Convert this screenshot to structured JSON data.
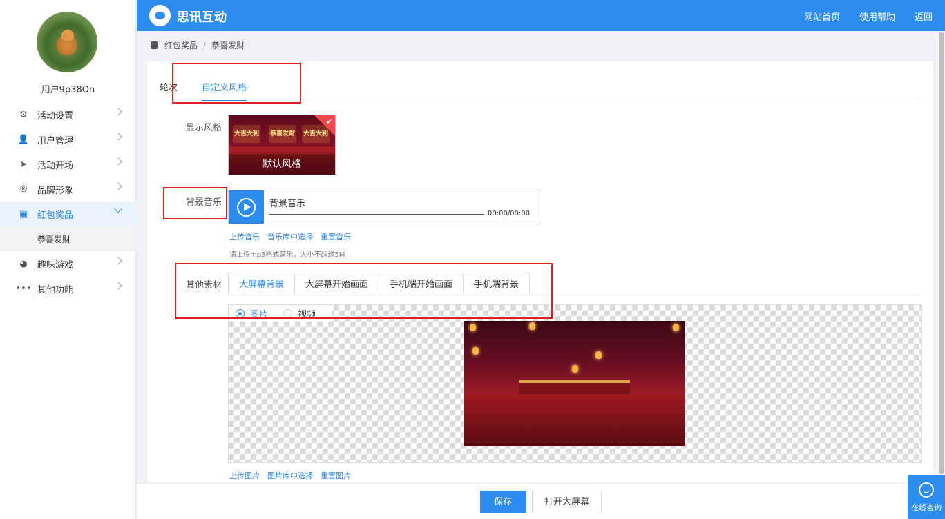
{
  "app": {
    "title": "思讯互动"
  },
  "nav": {
    "home": "网站首页",
    "help": "使用帮助",
    "back": "返回"
  },
  "user": {
    "name": "用户9p38On"
  },
  "sidebar": {
    "items": [
      {
        "label": "活动设置",
        "icon": "gear-icon"
      },
      {
        "label": "用户管理",
        "icon": "user-icon"
      },
      {
        "label": "活动开场",
        "icon": "paper-plane-icon"
      },
      {
        "label": "品牌形象",
        "icon": "registered-icon"
      },
      {
        "label": "红包奖品",
        "icon": "gift-icon"
      },
      {
        "label": "趣味游戏",
        "icon": "game-icon"
      },
      {
        "label": "其他功能",
        "icon": "more-icon"
      }
    ],
    "submenu": {
      "label": "恭喜发财"
    }
  },
  "breadcrumb": {
    "parent": "红包奖品",
    "current": "恭喜发财"
  },
  "tabs": [
    {
      "label": "轮次"
    },
    {
      "label": "自定义风格"
    }
  ],
  "style": {
    "label": "显示风格",
    "card_caption": "默认风格",
    "mini1": "大吉大利",
    "mini2": "恭喜发财",
    "mini3": "大吉大利"
  },
  "music": {
    "label": "背景音乐",
    "title": "背景音乐",
    "time": "00:00/00:00",
    "links": {
      "upload": "上传音乐",
      "library": "音乐库中选择",
      "reset": "重置音乐"
    },
    "hint": "请上传mp3格式音乐，大小不超过5M"
  },
  "material": {
    "label": "其他素材",
    "tabs": [
      {
        "label": "大屏幕背景"
      },
      {
        "label": "大屏幕开始画面"
      },
      {
        "label": "手机端开始画面"
      },
      {
        "label": "手机端背景"
      }
    ],
    "radio": {
      "image": "图片",
      "video": "视频"
    },
    "links": {
      "upload": "上传图片",
      "library": "图片库中选择",
      "reset": "重置图片"
    }
  },
  "footer": {
    "save": "保存",
    "open_screen": "打开大屏幕"
  },
  "consult": {
    "label": "在线咨询"
  },
  "colors": {
    "primary": "#2d8cf0",
    "highlight": "#e02020"
  }
}
